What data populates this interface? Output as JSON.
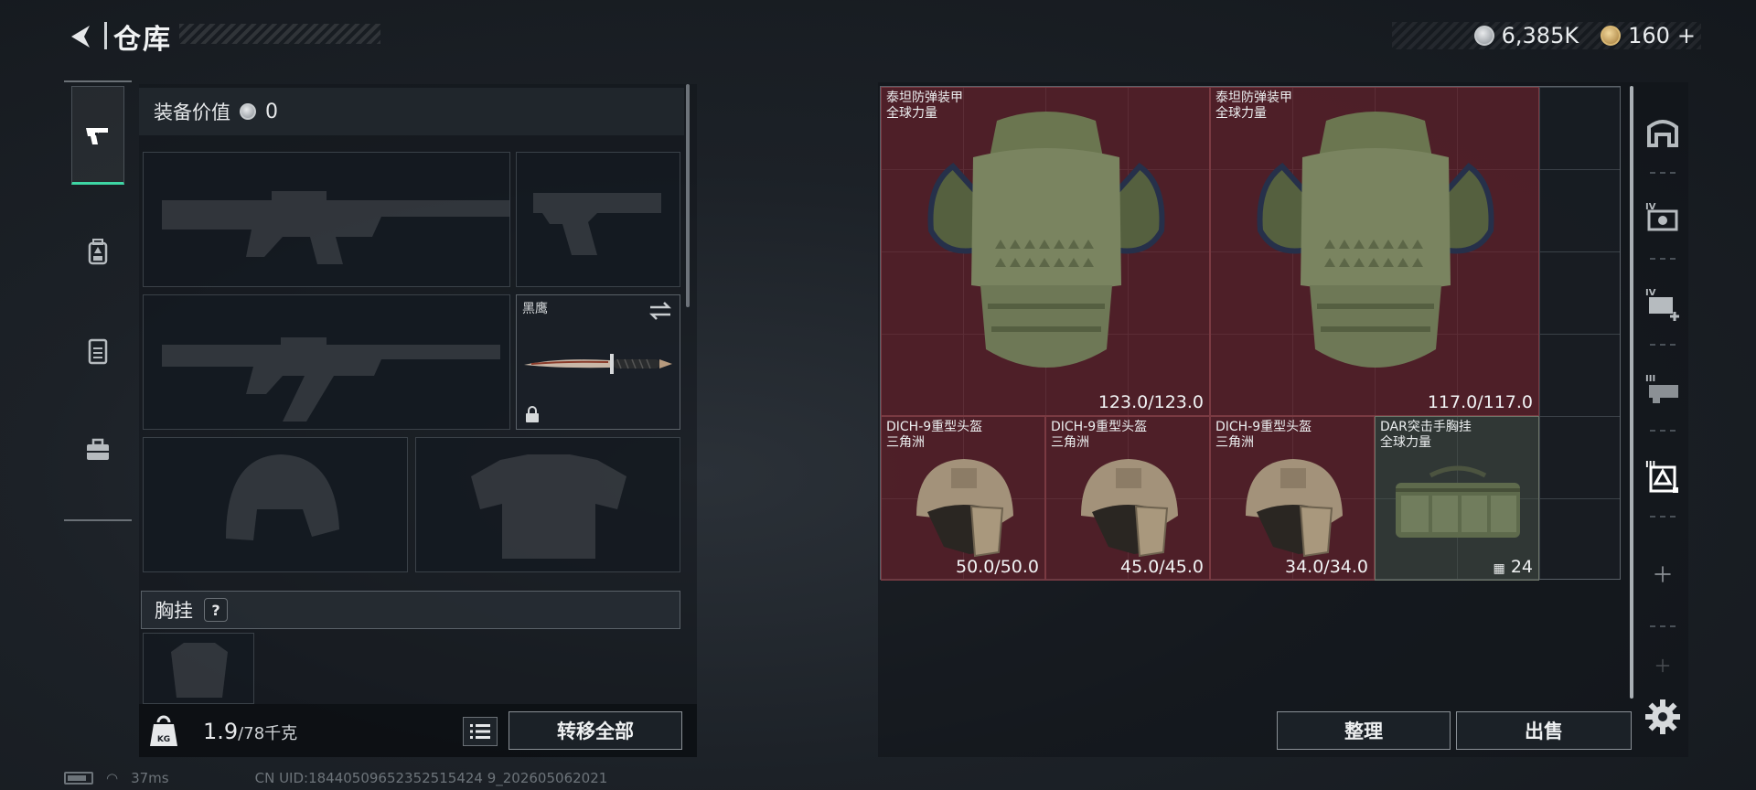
{
  "header": {
    "title": "仓库",
    "currency_silver": "6,385K",
    "currency_gold": "160",
    "gold_plus": "+"
  },
  "loadout": {
    "value_label": "装备价值",
    "value_amount": "0",
    "knife_name": "黑鹰",
    "chest_label": "胸挂",
    "chest_help": "?",
    "weight_current": "1.9",
    "weight_max": "/78千克",
    "transfer_all": "转移全部"
  },
  "stash": {
    "items": [
      {
        "name": "泰坦防弹装甲",
        "sub": "全球力量",
        "durability": "123.0/123.0"
      },
      {
        "name": "泰坦防弹装甲",
        "sub": "全球力量",
        "durability": "117.0/117.0"
      },
      {
        "name": "DICH-9重型头盔",
        "sub": "三角洲",
        "durability": "50.0/50.0"
      },
      {
        "name": "DICH-9重型头盔",
        "sub": "三角洲",
        "durability": "45.0/45.0"
      },
      {
        "name": "DICH-9重型头盔",
        "sub": "三角洲",
        "durability": "34.0/34.0"
      },
      {
        "name": "DAR突击手胸挂",
        "sub": "全球力量",
        "capacity": "24"
      }
    ],
    "sort_button": "整理",
    "sell_button": "出售"
  },
  "status": {
    "ping": "37ms",
    "uid": "CN UID:18440509652352515424 9_202605062021"
  },
  "colors": {
    "accent": "#3ed6a4",
    "item_red": "#70222c"
  }
}
